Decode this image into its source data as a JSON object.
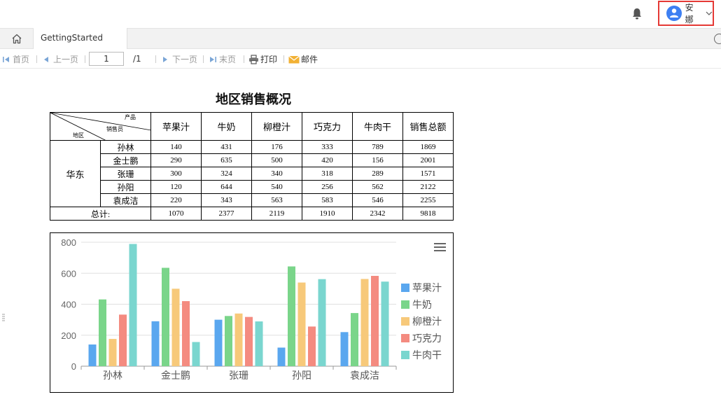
{
  "user": {
    "name": "安娜"
  },
  "tabs": {
    "doc_label": "GettingStarted"
  },
  "toolbar": {
    "first": "首页",
    "prev": "上一页",
    "page_value": "1",
    "page_total": "/1",
    "next": "下一页",
    "last": "末页",
    "print": "打印",
    "mail": "邮件"
  },
  "report": {
    "title": "地区销售概况",
    "diag": {
      "product": "产品",
      "salesperson": "销售员",
      "region": "地区"
    },
    "columns": [
      "苹果汁",
      "牛奶",
      "柳橙汁",
      "巧克力",
      "牛肉干",
      "销售总额"
    ],
    "region": "华东",
    "rows": [
      {
        "name": "孙林",
        "values": [
          "140",
          "431",
          "176",
          "333",
          "789",
          "1869"
        ]
      },
      {
        "name": "金士鹏",
        "values": [
          "290",
          "635",
          "500",
          "420",
          "156",
          "2001"
        ]
      },
      {
        "name": "张珊",
        "values": [
          "300",
          "324",
          "340",
          "318",
          "289",
          "1571"
        ]
      },
      {
        "name": "孙阳",
        "values": [
          "120",
          "644",
          "540",
          "256",
          "562",
          "2122"
        ]
      },
      {
        "name": "袁成洁",
        "values": [
          "220",
          "343",
          "563",
          "583",
          "546",
          "2255"
        ]
      }
    ],
    "total_label": "总计:",
    "totals": [
      "1070",
      "2377",
      "2119",
      "1910",
      "2342",
      "9818"
    ]
  },
  "chart_data": {
    "type": "bar",
    "categories": [
      "孙林",
      "金士鹏",
      "张珊",
      "孙阳",
      "袁成洁"
    ],
    "series": [
      {
        "name": "苹果汁",
        "color": "#5aa7ef",
        "values": [
          140,
          290,
          300,
          120,
          220
        ]
      },
      {
        "name": "牛奶",
        "color": "#7ad58a",
        "values": [
          431,
          635,
          324,
          644,
          343
        ]
      },
      {
        "name": "柳橙汁",
        "color": "#f7c97a",
        "values": [
          176,
          500,
          340,
          540,
          563
        ]
      },
      {
        "name": "巧克力",
        "color": "#f48b80",
        "values": [
          333,
          420,
          318,
          256,
          583
        ]
      },
      {
        "name": "牛肉干",
        "color": "#7ad6cf",
        "values": [
          789,
          156,
          289,
          562,
          546
        ]
      }
    ],
    "yticks": [
      "0",
      "200",
      "400",
      "600",
      "800"
    ],
    "ylim": [
      0,
      800
    ],
    "grid": true,
    "legend_position": "right"
  }
}
